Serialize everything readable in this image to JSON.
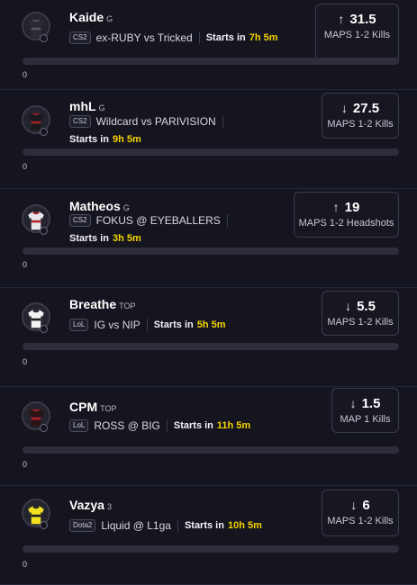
{
  "colors": {
    "background": "#15151f",
    "accent_time": "#f5d400",
    "track": "#2d2d3c"
  },
  "cards": [
    {
      "player": "Kaide",
      "tag": "G",
      "game": "CS2",
      "matchup": "ex-RUBY vs Tricked",
      "starts_label": "Starts in",
      "starts_value": "7h 5m",
      "direction_icon": "arrow-up-icon",
      "line": "31.5",
      "market": "MAPS 1-2 Kills",
      "progress_value": "0",
      "progress_fraction": 0,
      "jersey": [
        "#2b2b33",
        "#55555e"
      ]
    },
    {
      "player": "mhL",
      "tag": "G",
      "game": "CS2",
      "matchup": "Wildcard vs PARIVISION",
      "starts_label": "Starts in",
      "starts_value": "9h 5m",
      "direction_icon": "arrow-down-icon",
      "line": "27.5",
      "market": "MAPS 1-2 Kills",
      "progress_value": "0",
      "progress_fraction": 0,
      "jersey": [
        "#1a1a1e",
        "#a3202a"
      ]
    },
    {
      "player": "Matheos",
      "tag": "G",
      "game": "CS2",
      "matchup": "FOKUS @ EYEBALLERS",
      "starts_label": "Starts in",
      "starts_value": "3h 5m",
      "direction_icon": "arrow-up-icon",
      "line": "19",
      "market": "MAPS 1-2 Headshots",
      "progress_value": "0",
      "progress_fraction": 0,
      "jersey": [
        "#e8e8ec",
        "#b3202c"
      ]
    },
    {
      "player": "Breathe",
      "tag": "TOP",
      "game": "LoL",
      "matchup": "IG vs NIP",
      "starts_label": "Starts in",
      "starts_value": "5h 5m",
      "direction_icon": "arrow-down-icon",
      "line": "5.5",
      "market": "MAPS 1-2 Kills",
      "progress_value": "0",
      "progress_fraction": 0,
      "jersey": [
        "#f2f2f2",
        "#1c1c22"
      ]
    },
    {
      "player": "CPM",
      "tag": "TOP",
      "game": "LoL",
      "matchup": "ROSS @ BIG",
      "starts_label": "Starts in",
      "starts_value": "11h 5m",
      "direction_icon": "arrow-down-icon",
      "line": "1.5",
      "market": "MAP 1 Kills",
      "progress_value": "0",
      "progress_fraction": 0,
      "jersey": [
        "#2a1416",
        "#b3202c"
      ]
    },
    {
      "player": "Vazya",
      "tag": "3",
      "game": "Dota2",
      "matchup": "Liquid @ L1ga",
      "starts_label": "Starts in",
      "starts_value": "10h 5m",
      "direction_icon": "arrow-down-icon",
      "line": "6",
      "market": "MAPS 1-2 Kills",
      "progress_value": "0",
      "progress_fraction": 0,
      "jersey": [
        "#f0e020",
        "#1c1c22"
      ]
    }
  ]
}
